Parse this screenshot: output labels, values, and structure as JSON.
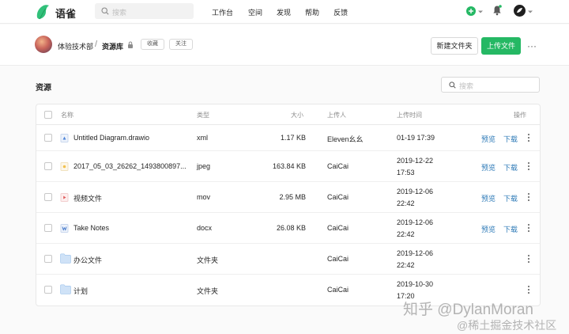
{
  "app": {
    "brand": "语雀",
    "search_placeholder": "搜索",
    "nav": [
      "工作台",
      "空间",
      "发现",
      "帮助",
      "反馈"
    ],
    "accent_color": "#25b864"
  },
  "header": {
    "team": "体验技术部",
    "separator": "/",
    "library": "资源库",
    "favorite_label": "收藏",
    "follow_label": "关注",
    "new_folder_label": "新建文件夹",
    "upload_label": "上传文件",
    "more_label": "···"
  },
  "section": {
    "title": "资源",
    "search_placeholder": "搜索"
  },
  "table": {
    "columns": {
      "name": "名称",
      "type": "类型",
      "size": "大小",
      "uploader": "上传人",
      "time": "上传时间",
      "actions": "操作"
    },
    "rows": [
      {
        "name": "Untitled Diagram.drawio",
        "icon": "drawio-file-icon",
        "type": "xml",
        "size": "1.17 KB",
        "uploader": "Eleven幺幺",
        "time_line1": "01-19 17:39",
        "time_line2": "",
        "preview": "预览",
        "download": "下载"
      },
      {
        "name": "2017_05_03_26262_1493800897...",
        "icon": "image-file-icon",
        "type": "jpeg",
        "size": "163.84 KB",
        "uploader": "CaiCai",
        "time_line1": "2019-12-22",
        "time_line2": "17:53",
        "preview": "预览",
        "download": "下载"
      },
      {
        "name": "视频文件",
        "icon": "video-file-icon",
        "type": "mov",
        "size": "2.95 MB",
        "uploader": "CaiCai",
        "time_line1": "2019-12-06",
        "time_line2": "22:42",
        "preview": "预览",
        "download": "下载"
      },
      {
        "name": "Take Notes",
        "icon": "word-file-icon",
        "type": "docx",
        "size": "26.08 KB",
        "uploader": "CaiCai",
        "time_line1": "2019-12-06",
        "time_line2": "22:42",
        "preview": "预览",
        "download": "下载"
      },
      {
        "name": "办公文件",
        "icon": "folder-icon",
        "type": "文件夹",
        "size": "",
        "uploader": "CaiCai",
        "time_line1": "2019-12-06",
        "time_line2": "22:42",
        "preview": "",
        "download": ""
      },
      {
        "name": "计划",
        "icon": "folder-icon",
        "type": "文件夹",
        "size": "",
        "uploader": "CaiCai",
        "time_line1": "2019-10-30",
        "time_line2": "17:20",
        "preview": "",
        "download": ""
      }
    ]
  },
  "watermark": {
    "line1": "知乎 @DylanMoran",
    "line2": "@稀土掘金技术社区"
  }
}
